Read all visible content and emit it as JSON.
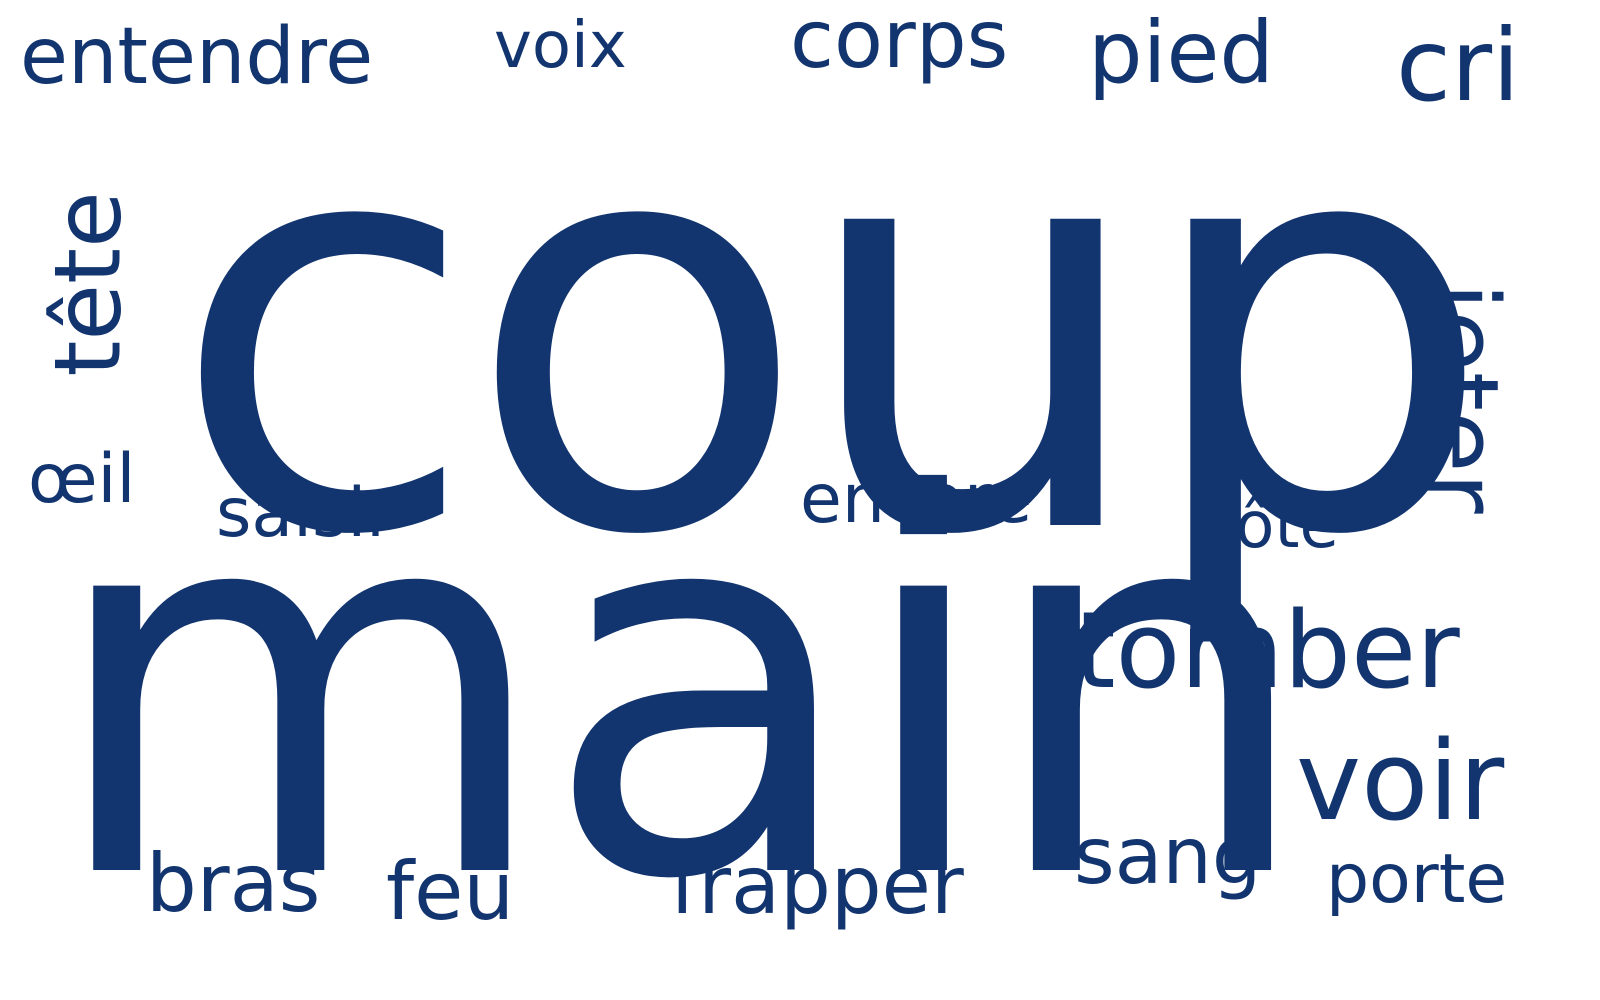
{
  "color": "#13356f",
  "background": "#ffffff",
  "words": [
    {
      "text": "coup",
      "weight": 1
    },
    {
      "text": "main",
      "weight": 2
    },
    {
      "text": "tête",
      "weight": 3,
      "orientation": "vertical"
    },
    {
      "text": "jeter",
      "weight": 3,
      "orientation": "vertical"
    },
    {
      "text": "tomber",
      "weight": 4
    },
    {
      "text": "voir",
      "weight": 5
    },
    {
      "text": "cri",
      "weight": 6
    },
    {
      "text": "corps",
      "weight": 7
    },
    {
      "text": "pied",
      "weight": 8
    },
    {
      "text": "entendre",
      "weight": 9
    },
    {
      "text": "voix",
      "weight": 10
    },
    {
      "text": "œil",
      "weight": 11
    },
    {
      "text": "saisir",
      "weight": 12
    },
    {
      "text": "encore",
      "weight": 13
    },
    {
      "text": "côté",
      "weight": 14
    },
    {
      "text": "sang",
      "weight": 15
    },
    {
      "text": "porte",
      "weight": 16
    },
    {
      "text": "bras",
      "weight": 17
    },
    {
      "text": "feu",
      "weight": 18
    },
    {
      "text": "frapper",
      "weight": 19
    }
  ]
}
